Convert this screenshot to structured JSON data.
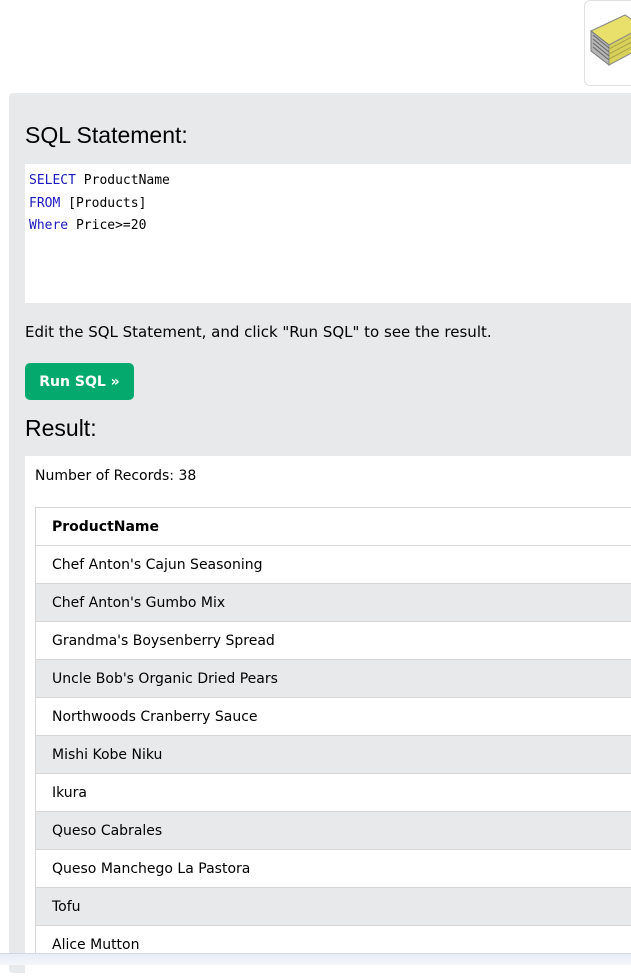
{
  "sql_section": {
    "heading": "SQL Statement:",
    "lines": [
      {
        "keyword": "SELECT",
        "rest": " ProductName"
      },
      {
        "keyword": "FROM",
        "rest": " [Products]"
      },
      {
        "keyword": "Where",
        "rest": " Price>=20"
      }
    ],
    "instructions": "Edit the SQL Statement, and click \"Run SQL\" to see the result.",
    "run_button_label": "Run SQL »"
  },
  "result_section": {
    "heading": "Result:",
    "record_count": "Number of Records: 38",
    "column_header": "ProductName",
    "rows": [
      "Chef Anton's Cajun Seasoning",
      "Chef Anton's Gumbo Mix",
      "Grandma's Boysenberry Spread",
      "Uncle Bob's Organic Dried Pears",
      "Northwoods Cranberry Sauce",
      "Mishi Kobe Niku",
      "Ikura",
      "Queso Cabrales",
      "Queso Manchego La Pastora",
      "Tofu",
      "Alice Mutton"
    ]
  },
  "colors": {
    "run_button": "#04aa6d",
    "panel_background": "#e7e9eb",
    "sql_keyword": "#1b1bbf"
  },
  "icons": {
    "top_right_thumbnail": "book-thumbnail-icon"
  }
}
